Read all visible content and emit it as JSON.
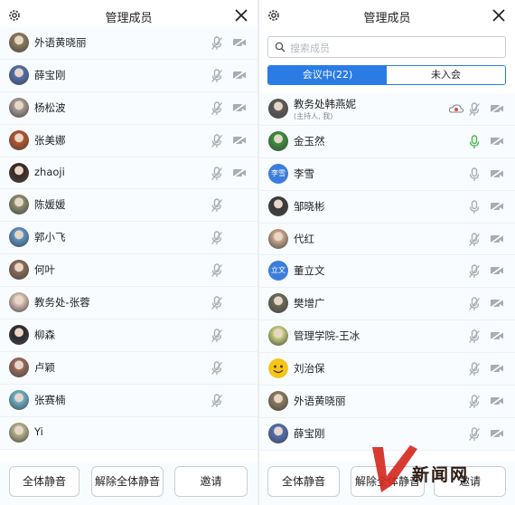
{
  "left_panel": {
    "title": "管理成员",
    "members": [
      {
        "name": "外语黄晓丽",
        "avatar": "photo",
        "color": "#8b7a5c",
        "mic": "muted",
        "cam": "off"
      },
      {
        "name": "薛宝刚",
        "avatar": "photo",
        "color": "#4f6fb3",
        "mic": "muted",
        "cam": "off"
      },
      {
        "name": "杨松波",
        "avatar": "photo",
        "color": "#a69a92",
        "mic": "muted",
        "cam": "off"
      },
      {
        "name": "张美娜",
        "avatar": "photo",
        "color": "#b6542f",
        "mic": "muted",
        "cam": "off"
      },
      {
        "name": "zhaoji",
        "avatar": "photo",
        "color": "#3a2a22",
        "mic": "muted",
        "cam": "off"
      },
      {
        "name": "陈媛媛",
        "avatar": "photo",
        "color": "#8a8d6a",
        "mic": "muted"
      },
      {
        "name": "郭小飞",
        "avatar": "photo",
        "color": "#5a93c8",
        "mic": "muted"
      },
      {
        "name": "何叶",
        "avatar": "photo",
        "color": "#8b6a55",
        "mic": "muted"
      },
      {
        "name": "教务处-张蓉",
        "avatar": "photo",
        "color": "#d9bfb2",
        "mic": "muted"
      },
      {
        "name": "柳森",
        "avatar": "photo",
        "color": "#2b2b30",
        "mic": "muted"
      },
      {
        "name": "卢颖",
        "avatar": "photo",
        "color": "#9a6a5a",
        "mic": "muted"
      },
      {
        "name": "张赛楠",
        "avatar": "photo",
        "color": "#6ab0c8",
        "mic": "muted"
      },
      {
        "name": "Yi",
        "avatar": "photo",
        "color": "#b7b08a"
      }
    ],
    "buttons": {
      "mute_all": "全体静音",
      "unmute_all": "解除全体静音",
      "invite": "邀请"
    }
  },
  "right_panel": {
    "title": "管理成员",
    "search_placeholder": "搜索成员",
    "tabs": {
      "in_meeting": "会议中(22)",
      "not_joined": "未入会"
    },
    "members": [
      {
        "name": "教务处韩燕妮",
        "sub": "(主持人, 我)",
        "avatar": "photo",
        "color": "#5a5a5a",
        "cloud": true,
        "mic": "muted",
        "cam": "off"
      },
      {
        "name": "金玉然",
        "avatar": "photo",
        "color": "#3a8f3a",
        "mic": "active",
        "cam": "off"
      },
      {
        "name": "李雪",
        "avatar": "letter",
        "avatar_text": "李雪",
        "color": "#3b7ddc",
        "mic": "on",
        "cam": "off"
      },
      {
        "name": "邹晓彬",
        "avatar": "photo",
        "color": "#3a3a3a",
        "mic": "on",
        "cam": "off"
      },
      {
        "name": "代红",
        "avatar": "photo",
        "color": "#c8a58a",
        "mic": "muted",
        "cam": "off"
      },
      {
        "name": "董立文",
        "avatar": "letter",
        "avatar_text": "立文",
        "color": "#3b7ddc",
        "mic": "muted",
        "cam": "off"
      },
      {
        "name": "樊增广",
        "avatar": "photo",
        "color": "#6a6a5a",
        "mic": "muted",
        "cam": "off"
      },
      {
        "name": "管理学院-王冰",
        "avatar": "photo",
        "color": "#c9d17a",
        "mic": "muted",
        "cam": "off"
      },
      {
        "name": "刘治保",
        "avatar": "emoji",
        "color": "#f5c518",
        "mic": "muted",
        "cam": "off"
      },
      {
        "name": "外语黄晓丽",
        "avatar": "photo",
        "color": "#8b7a5c",
        "mic": "muted",
        "cam": "off"
      },
      {
        "name": "薛宝刚",
        "avatar": "photo",
        "color": "#4f6fb3",
        "mic": "muted",
        "cam": "off"
      }
    ],
    "buttons": {
      "mute_all": "全体静音",
      "unmute_all": "解除全体静音",
      "invite": "邀请"
    }
  },
  "watermark": {
    "text": "新闻网"
  },
  "colors": {
    "accent": "#2a7be4",
    "icon_gray": "#a7adb6",
    "mic_active": "#49b34a",
    "cloud_red": "#e14b4b"
  }
}
